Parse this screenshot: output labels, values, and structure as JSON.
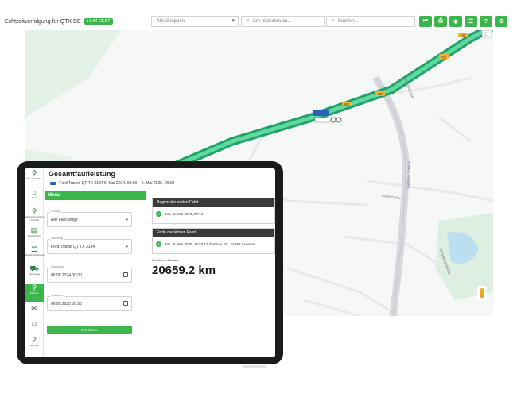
{
  "topbar": {
    "title": "Echtzeitverfolgung für QTX DE",
    "time_badge": "17:34 CEST",
    "group_select": "Alle Gruppen",
    "nearest_placeholder": "Am nächsten an...",
    "search_placeholder": "Suchen..."
  },
  "toolbar_icons": [
    "skip-back-icon",
    "print-icon",
    "layers-icon",
    "list-icon",
    "help-icon",
    "settings-icon"
  ],
  "toolbar_glyphs": [
    "⏮",
    "⎙",
    "◈",
    "☰",
    "?",
    "⚙"
  ],
  "map": {
    "road_badges": [
      "K8",
      "K8",
      "K8",
      "K8"
    ],
    "street_labels": [
      "Hauptstraße",
      "Stettiner Straße",
      "Feldstraße",
      "Weinbergstraße"
    ],
    "fullscreen_glyph": "⛶"
  },
  "app": {
    "page_title": "Gesamtfaufleistung",
    "vehicle": "Ford Transit QT TX 3134",
    "date_range": "6. Mai 2024, 00:00 – 6. Mai 2025, 00:00",
    "sidebar": [
      {
        "label": "Übersicht / Bar",
        "glyph": "⚲"
      },
      {
        "label": "Start",
        "glyph": "⌂"
      },
      {
        "label": "Echtzeitverfolgung / Verlauf",
        "glyph": "⚲"
      },
      {
        "label": "Routenlisten",
        "glyph": "▤"
      },
      {
        "label": "Benachrichtigungen",
        "glyph": "☰"
      },
      {
        "label": "Fahrzeuge",
        "glyph": "⛟"
      },
      {
        "label": "Fahrten",
        "glyph": "⚲"
      },
      {
        "label": "",
        "glyph": "✉"
      },
      {
        "label": "",
        "glyph": "☺"
      },
      {
        "label": "Berichte",
        "glyph": "?"
      }
    ],
    "menu": {
      "header": "Menu",
      "group_label": "Gruppe",
      "group_value": "Alle Fahrzeuge",
      "vehicle_label": "Fahrzeug",
      "vehicle_value": "Ford Transit QT TX 3134",
      "start_label": "Startdatum",
      "start_value": "06.05.2024 00:00",
      "end_label": "Enddatum",
      "end_value": "06.05.2025 00:00",
      "button": "Errechnen"
    },
    "first_trip": {
      "header": "Beginn der ersten Fahrt",
      "value": "Mo., 6. Mai 2024, 07:14"
    },
    "last_trip": {
      "header": "Ende der letzten Fahrt",
      "value": "Mo., 5. Mai 2025, 16:52   12 Stettiner Str., 01867 Lauenau"
    },
    "distance": {
      "label": "Gefahrene Distanz",
      "value": "20659.2 km"
    }
  },
  "colors": {
    "accent": "#3cb54a",
    "dark_header": "#3a3a3a",
    "route": "#2fbf7f"
  }
}
